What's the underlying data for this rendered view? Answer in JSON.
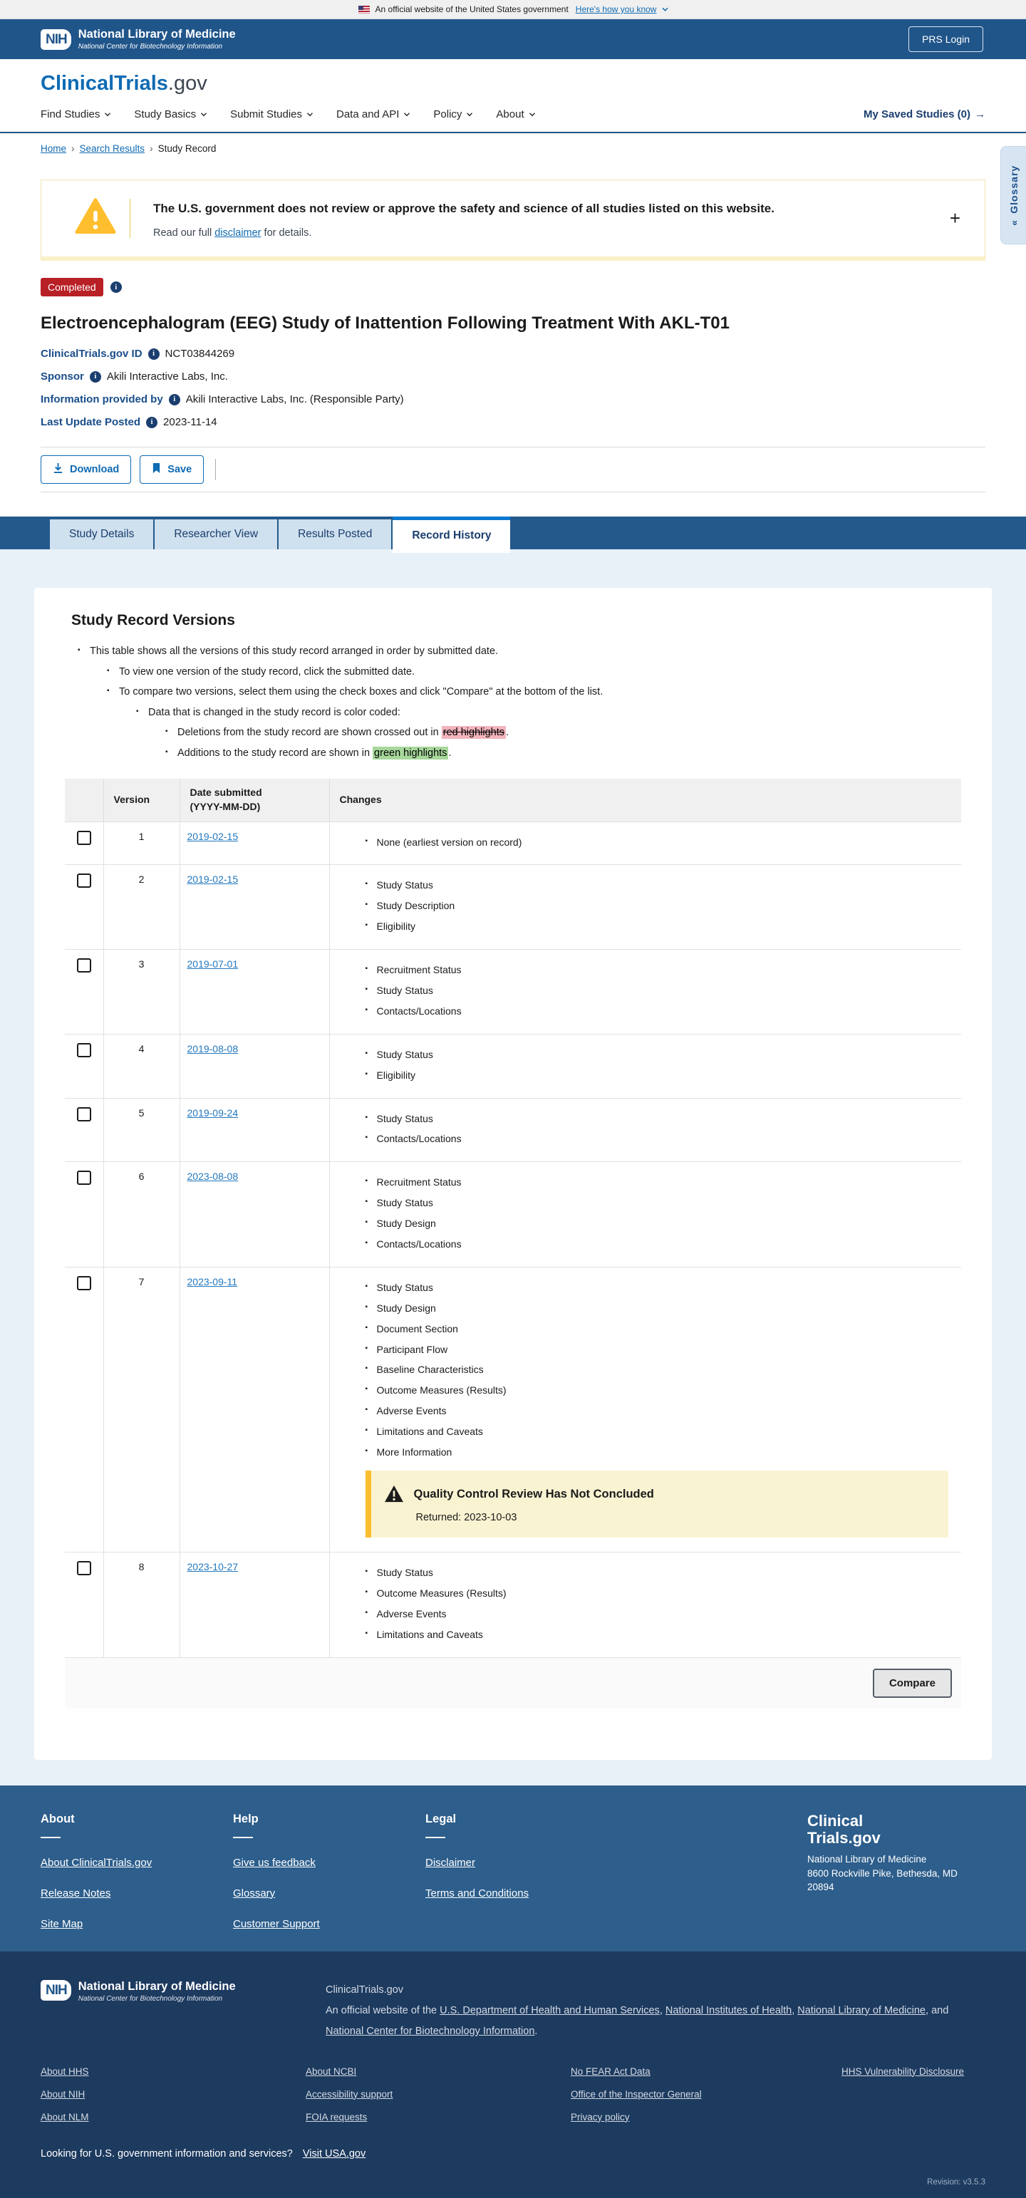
{
  "banner": {
    "text": "An official website of the United States government",
    "link": "Here's how you know"
  },
  "nlm_header": {
    "nih": "NIH",
    "org": "National Library of Medicine",
    "sub": "National Center for Biotechnology Information",
    "login": "PRS Login"
  },
  "site": {
    "brand_primary": "ClinicalTrials",
    "brand_suffix": ".gov"
  },
  "nav": {
    "items": [
      {
        "label": "Find Studies"
      },
      {
        "label": "Study Basics"
      },
      {
        "label": "Submit Studies"
      },
      {
        "label": "Data and API"
      },
      {
        "label": "Policy"
      },
      {
        "label": "About"
      }
    ],
    "saved": "My Saved Studies (0)",
    "saved_arrow": "→"
  },
  "breadcrumb": {
    "home": "Home",
    "results": "Search Results",
    "current": "Study Record",
    "sep": "›"
  },
  "glossary": {
    "label": "Glossary",
    "collapse": "«"
  },
  "warning": {
    "title": "The U.S. government does not review or approve the safety and science of all studies listed on this website.",
    "body_prefix": "Read our full ",
    "link": "disclaimer",
    "body_suffix": " for details.",
    "expand": "+"
  },
  "study": {
    "status": "Completed",
    "title": "Electroencephalogram (EEG) Study of Inattention Following Treatment With AKL-T01",
    "meta": [
      {
        "label": "ClinicalTrials.gov ID",
        "value": "NCT03844269"
      },
      {
        "label": "Sponsor",
        "value": "Akili Interactive Labs, Inc."
      },
      {
        "label": "Information provided by",
        "value": "Akili Interactive Labs, Inc. (Responsible Party)"
      },
      {
        "label": "Last Update Posted",
        "value": "2023-11-14"
      }
    ]
  },
  "actions": {
    "download": "Download",
    "save": "Save"
  },
  "tabs": [
    {
      "label": "Study Details"
    },
    {
      "label": "Researcher View"
    },
    {
      "label": "Results Posted"
    },
    {
      "label": "Record History"
    }
  ],
  "versions": {
    "heading": "Study Record Versions",
    "notes": {
      "intro": "This table shows all the versions of this study record arranged in order by submitted date.",
      "view": "To view one version of the study record, click the submitted date.",
      "compare": "To compare two versions, select them using the check boxes and click \"Compare\" at the bottom of the list.",
      "color": "Data that is changed in the study record is color coded:",
      "deletions_prefix": "Deletions from the study record are shown crossed out in ",
      "deletions_highlight": "red highlights",
      "deletions_suffix": ".",
      "additions_prefix": "Additions to the study record are shown in ",
      "additions_highlight": "green highlights",
      "additions_suffix": "."
    },
    "table": {
      "header_version": "Version",
      "header_date_line1": "Date submitted",
      "header_date_line2": "(YYYY-MM-DD)",
      "header_changes": "Changes",
      "rows": [
        {
          "version": "1",
          "date": "2019-02-15",
          "changes": [
            "None (earliest version on record)"
          ]
        },
        {
          "version": "2",
          "date": "2019-02-15",
          "changes": [
            "Study Status",
            "Study Description",
            "Eligibility"
          ]
        },
        {
          "version": "3",
          "date": "2019-07-01",
          "changes": [
            "Recruitment Status",
            "Study Status",
            "Contacts/Locations"
          ]
        },
        {
          "version": "4",
          "date": "2019-08-08",
          "changes": [
            "Study Status",
            "Eligibility"
          ]
        },
        {
          "version": "5",
          "date": "2019-09-24",
          "changes": [
            "Study Status",
            "Contacts/Locations"
          ]
        },
        {
          "version": "6",
          "date": "2023-08-08",
          "changes": [
            "Recruitment Status",
            "Study Status",
            "Study Design",
            "Contacts/Locations"
          ]
        },
        {
          "version": "7",
          "date": "2023-09-11",
          "changes": [
            "Study Status",
            "Study Design",
            "Document Section",
            "Participant Flow",
            "Baseline Characteristics",
            "Outcome Measures (Results)",
            "Adverse Events",
            "Limitations and Caveats",
            "More Information"
          ],
          "qc": {
            "title": "Quality Control Review Has Not Concluded",
            "returned": "Returned: 2023-10-03"
          }
        },
        {
          "version": "8",
          "date": "2023-10-27",
          "changes": [
            "Study Status",
            "Outcome Measures (Results)",
            "Adverse Events",
            "Limitations and Caveats"
          ]
        }
      ],
      "compare_label": "Compare"
    }
  },
  "footer": {
    "columns": [
      {
        "heading": "About",
        "links": [
          "About ClinicalTrials.gov",
          "Release Notes",
          "Site Map"
        ]
      },
      {
        "heading": "Help",
        "links": [
          "Give us feedback",
          "Glossary",
          "Customer Support"
        ]
      },
      {
        "heading": "Legal",
        "links": [
          "Disclaimer",
          "Terms and Conditions"
        ]
      }
    ],
    "brand_line1": "Clinical",
    "brand_line2": "Trials.gov",
    "org": "National Library of Medicine",
    "address": "8600 Rockville Pike, Bethesda, MD 20894"
  },
  "subfooter": {
    "nih": "NIH",
    "org": "National Library of Medicine",
    "sub": "National Center for Biotechnology Information",
    "site": "ClinicalTrials.gov",
    "official_prefix": "An official website of the ",
    "links": [
      "U.S. Department of Health and Human Services",
      "National Institutes of Health",
      "National Library of Medicine",
      "National Center for Biotechnology Information"
    ],
    "sep": ", ",
    "and_word": "and ",
    "period": ".",
    "link_columns": [
      [
        "About HHS",
        "About NIH",
        "About NLM"
      ],
      [
        "About NCBI",
        "Accessibility support",
        "FOIA requests"
      ],
      [
        "No FEAR Act Data",
        "Office of the Inspector General",
        "Privacy policy"
      ],
      [
        "HHS Vulnerability Disclosure"
      ]
    ],
    "usa_prompt": "Looking for U.S. government information and services?",
    "usa_link": "Visit USA.gov",
    "revision": "Revision: v3.5.3"
  }
}
